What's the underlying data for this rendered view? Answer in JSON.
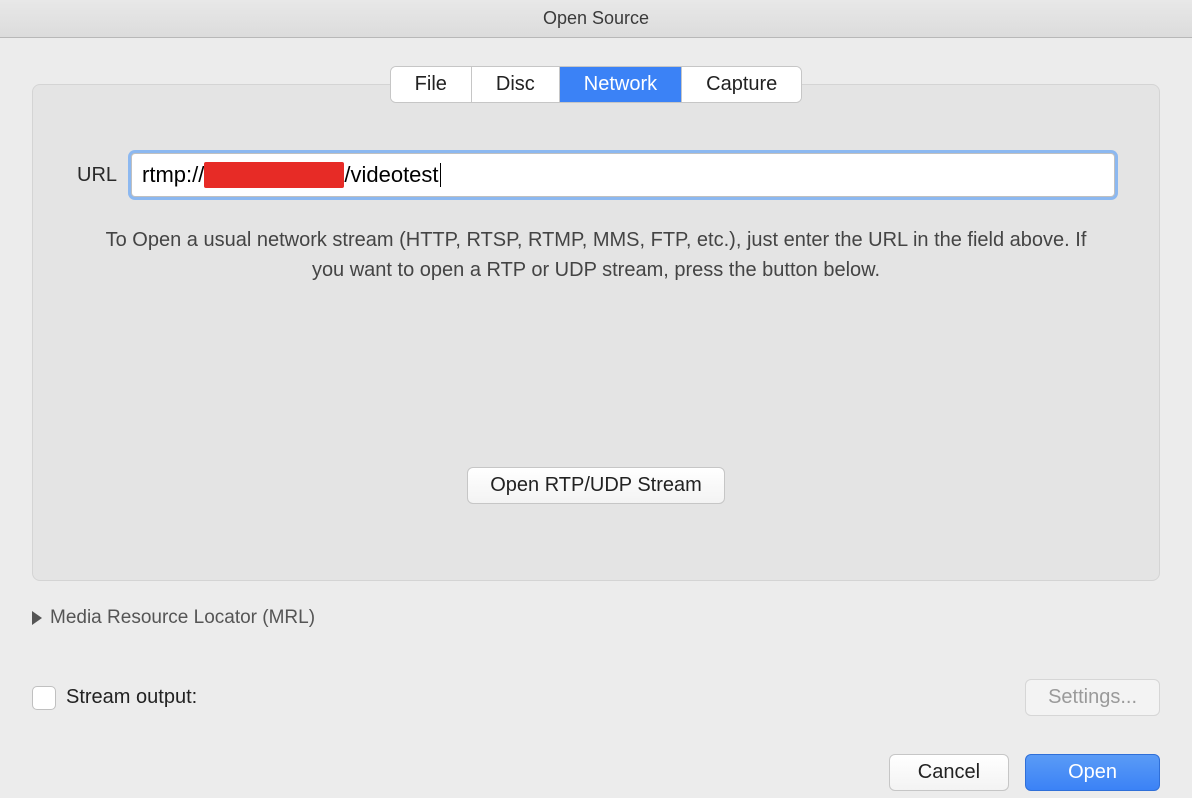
{
  "window": {
    "title": "Open Source"
  },
  "tabs": {
    "file": "File",
    "disc": "Disc",
    "network": "Network",
    "capture": "Capture",
    "active": "network"
  },
  "network": {
    "url_label": "URL",
    "url_prefix": "rtmp://",
    "url_suffix": "/videotest",
    "help_text": "To Open a usual network stream (HTTP, RTSP, RTMP, MMS, FTP, etc.), just enter the URL in the field above. If you want to open a RTP or UDP stream, press the button below.",
    "rtp_button": "Open RTP/UDP Stream"
  },
  "mrl": {
    "label": "Media Resource Locator (MRL)"
  },
  "stream_output": {
    "label": "Stream output:",
    "checked": false,
    "settings_label": "Settings..."
  },
  "footer": {
    "cancel": "Cancel",
    "open": "Open"
  }
}
